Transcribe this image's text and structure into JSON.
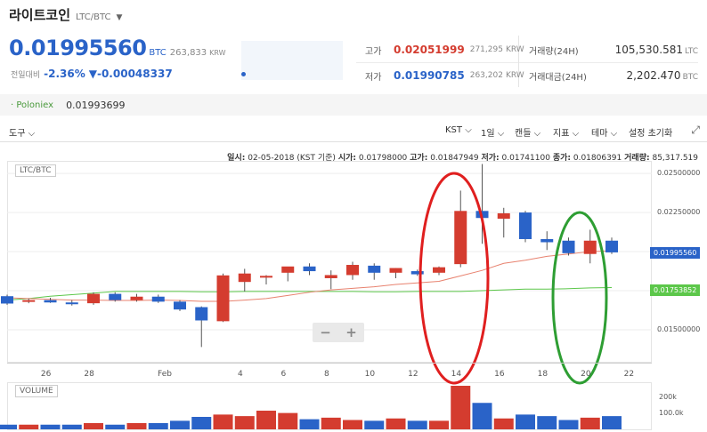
{
  "header": {
    "coin_name": "라이트코인",
    "pair": "LTC/BTC"
  },
  "price": {
    "current": "0.01995560",
    "unit": "BTC",
    "krw": "263,833",
    "krw_unit": "KRW",
    "change_label": "전일대비",
    "change_pct": "-2.36%",
    "change_abs": "▼-0.00048337"
  },
  "stats": {
    "high_label": "고가",
    "high_value": "0.02051999",
    "high_krw": "271,295",
    "low_label": "저가",
    "low_value": "0.01990785",
    "low_krw": "263,202",
    "krw_unit": "KRW",
    "volume_label": "거래량(24H)",
    "volume_value": "105,530.581",
    "volume_unit": "LTC",
    "amount_label": "거래대금(24H)",
    "amount_value": "2,202.470",
    "amount_unit": "BTC"
  },
  "exchange": {
    "name": "Poloniex",
    "price": "0.01993699"
  },
  "toolbar": {
    "tools": "도구",
    "timezone": "KST",
    "interval": "1일",
    "candle": "캔들",
    "indicator": "지표",
    "theme": "테마",
    "reset": "설정 초기화"
  },
  "ohlc": {
    "date_label": "일시:",
    "date_value": "02-05-2018 (KST 기준)",
    "open_label": "시가:",
    "open_value": "0.01798000",
    "high_label": "고가:",
    "high_value": "0.01847949",
    "low_label": "저가:",
    "low_value": "0.01741100",
    "close_label": "종가:",
    "close_value": "0.01806391",
    "volume_label": "거래량:",
    "volume_value": "85,317.519"
  },
  "pane": {
    "pair_tag": "LTC/BTC",
    "volume_tag": "VOLUME",
    "zoom_out": "−",
    "zoom_in": "+"
  },
  "colors": {
    "up": "#d43c2f",
    "down": "#2a63c8",
    "ma_short": "#e8826f",
    "ma_long": "#5cc74a",
    "annotation_red": "#e01f1f",
    "annotation_green": "#2e9e33"
  },
  "chart_data": {
    "type": "candlestick",
    "y_ticks": [
      "0.02500000",
      "0.02250000",
      "0.02000000",
      "0.01750000",
      "0.01500000"
    ],
    "ylim": [
      0.0129,
      0.0258
    ],
    "price_tag_current": "0.01995560",
    "price_tag_ma": "0.01753852",
    "x_ticks": [
      "26",
      "28",
      "Feb",
      "4",
      "6",
      "8",
      "10",
      "12",
      "14",
      "16",
      "18",
      "20",
      "22"
    ],
    "volume_ticks": [
      "200k",
      "100.0k"
    ],
    "candles": [
      {
        "o": 0.01715,
        "h": 0.01725,
        "l": 0.0166,
        "c": 0.01668
      },
      {
        "o": 0.01685,
        "h": 0.017,
        "l": 0.0167,
        "c": 0.0169
      },
      {
        "o": 0.0169,
        "h": 0.01705,
        "l": 0.01672,
        "c": 0.01675
      },
      {
        "o": 0.01675,
        "h": 0.0169,
        "l": 0.01655,
        "c": 0.01665
      },
      {
        "o": 0.0167,
        "h": 0.0174,
        "l": 0.0166,
        "c": 0.0173
      },
      {
        "o": 0.0173,
        "h": 0.0174,
        "l": 0.0168,
        "c": 0.0169
      },
      {
        "o": 0.0169,
        "h": 0.0173,
        "l": 0.0168,
        "c": 0.01712
      },
      {
        "o": 0.01712,
        "h": 0.01725,
        "l": 0.01672,
        "c": 0.0168
      },
      {
        "o": 0.0168,
        "h": 0.0169,
        "l": 0.0162,
        "c": 0.0163
      },
      {
        "o": 0.01645,
        "h": 0.0165,
        "l": 0.0139,
        "c": 0.0156
      },
      {
        "o": 0.01555,
        "h": 0.0186,
        "l": 0.0155,
        "c": 0.01848
      },
      {
        "o": 0.01806,
        "h": 0.0189,
        "l": 0.01745,
        "c": 0.0186
      },
      {
        "o": 0.01835,
        "h": 0.0185,
        "l": 0.0179,
        "c": 0.01845
      },
      {
        "o": 0.01865,
        "h": 0.0189,
        "l": 0.0181,
        "c": 0.01905
      },
      {
        "o": 0.01905,
        "h": 0.01925,
        "l": 0.0185,
        "c": 0.01875
      },
      {
        "o": 0.0183,
        "h": 0.0188,
        "l": 0.0176,
        "c": 0.0185
      },
      {
        "o": 0.0185,
        "h": 0.01935,
        "l": 0.0182,
        "c": 0.01915
      },
      {
        "o": 0.0191,
        "h": 0.01925,
        "l": 0.0182,
        "c": 0.01865
      },
      {
        "o": 0.01865,
        "h": 0.01895,
        "l": 0.0183,
        "c": 0.01895
      },
      {
        "o": 0.01875,
        "h": 0.01885,
        "l": 0.01845,
        "c": 0.01855
      },
      {
        "o": 0.01865,
        "h": 0.01905,
        "l": 0.0185,
        "c": 0.019
      },
      {
        "o": 0.0192,
        "h": 0.0239,
        "l": 0.019,
        "c": 0.0226
      },
      {
        "o": 0.0226,
        "h": 0.0256,
        "l": 0.0205,
        "c": 0.02215
      },
      {
        "o": 0.0221,
        "h": 0.0228,
        "l": 0.0209,
        "c": 0.02245
      },
      {
        "o": 0.0225,
        "h": 0.0226,
        "l": 0.0206,
        "c": 0.0208
      },
      {
        "o": 0.0208,
        "h": 0.0213,
        "l": 0.0201,
        "c": 0.0206
      },
      {
        "o": 0.0207,
        "h": 0.0209,
        "l": 0.01975,
        "c": 0.0199
      },
      {
        "o": 0.01985,
        "h": 0.0214,
        "l": 0.01925,
        "c": 0.0207
      },
      {
        "o": 0.0207,
        "h": 0.0209,
        "l": 0.01985,
        "c": 0.01995
      }
    ],
    "candle_x_index": [
      0,
      1,
      2,
      3,
      4,
      5,
      6,
      7,
      8,
      9,
      10,
      11,
      12,
      13,
      14,
      15,
      16,
      17,
      18,
      19,
      20,
      21,
      22,
      23,
      24,
      25,
      26,
      27,
      28
    ],
    "volume": [
      30,
      30,
      30,
      30,
      40,
      30,
      40,
      40,
      55,
      80,
      95,
      85,
      120,
      105,
      65,
      75,
      60,
      55,
      70,
      55,
      55,
      280,
      170,
      70,
      95,
      85,
      60,
      75,
      85
    ],
    "volume_max": 280,
    "ma_short": [
      0.01705,
      0.017,
      0.01695,
      0.0169,
      0.0169,
      0.01688,
      0.01688,
      0.0169,
      0.01688,
      0.01682,
      0.01682,
      0.0169,
      0.017,
      0.0172,
      0.0174,
      0.01755,
      0.01765,
      0.01775,
      0.0179,
      0.018,
      0.0181,
      0.01845,
      0.0188,
      0.01925,
      0.01945,
      0.0197,
      0.01985,
      0.02,
      0.02005
    ],
    "ma_long": [
      0.0169,
      0.017,
      0.01715,
      0.01725,
      0.01735,
      0.01745,
      0.01745,
      0.01745,
      0.01745,
      0.01743,
      0.01743,
      0.01745,
      0.01745,
      0.01745,
      0.01745,
      0.01745,
      0.01745,
      0.01743,
      0.01743,
      0.01745,
      0.01745,
      0.01745,
      0.0175,
      0.01755,
      0.0176,
      0.0176,
      0.01763,
      0.01768,
      0.0177
    ]
  }
}
